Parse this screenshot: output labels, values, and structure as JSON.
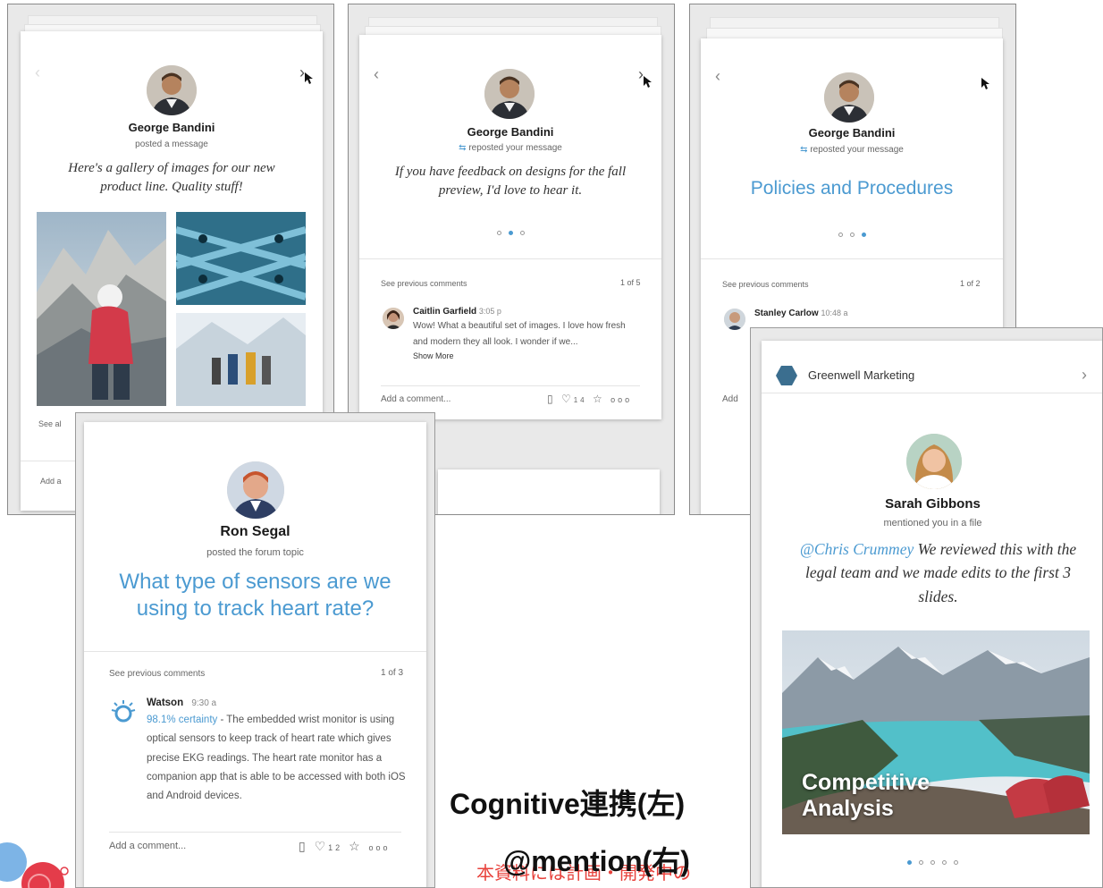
{
  "card1": {
    "name": "George Bandini",
    "action": "posted a message",
    "quote": "Here's a gallery of images for our new product line. Quality stuff!",
    "see_all": "See al",
    "add": "Add a"
  },
  "card2": {
    "name": "George Bandini",
    "action": "reposted your message",
    "quote": "If you have feedback on designs for the fall preview, I'd love to hear it.",
    "see_previous": "See previous comments",
    "count": "1 of 5",
    "comment": {
      "author": "Caitlin Garfield",
      "time": "3:05 p",
      "text": "Wow! What a beautiful set of images. I love how fresh and modern they all look. I wonder if we...",
      "show_more": "Show More"
    },
    "add_comment": "Add a comment...",
    "likes": "14"
  },
  "card3": {
    "name": "George Bandini",
    "action": "reposted your message",
    "title": "Policies and Procedures",
    "see_previous": "See previous comments",
    "count": "1 of 2",
    "comment": {
      "author": "Stanley Carlow",
      "time": "10:48 a"
    },
    "add": "Add"
  },
  "card4": {
    "name": "Ron Segal",
    "action": "posted the forum topic",
    "title": "What type of sensors are we using to track heart rate?",
    "see_previous": "See previous comments",
    "count": "1 of 3",
    "comment": {
      "author": "Watson",
      "time": "9:30 a",
      "certainty": "98.1% certainty",
      "text": " - The embedded wrist monitor is using optical sensors to keep track of heart rate which gives precise EKG readings. The heart rate monitor has a companion app that is able to be accessed with both iOS and Android devices."
    },
    "add_comment": "Add a comment...",
    "likes": "12"
  },
  "card5": {
    "community": "Greenwell Marketing",
    "name": "Sarah Gibbons",
    "action": "mentioned you in a file",
    "mention": "@Chris Crummey",
    "quote": " We reviewed this with the legal team and we made edits to the first 3 slides.",
    "file_title_1": "Competitive",
    "file_title_2": "Analysis"
  },
  "captions": {
    "cognitive": "Cognitive連携(左)",
    "mention": "@mention(右)",
    "disclaimer": "本資料には計画・開発中の"
  },
  "colors": {
    "accent": "#4b9ad1",
    "disclaimer": "#e8413b"
  },
  "icons": [
    "back-chevron-icon",
    "forward-chevron-icon",
    "repost-icon",
    "like-icon",
    "star-icon",
    "more-icon",
    "file-icon",
    "watson-icon",
    "community-hex-icon",
    "cursor-icon"
  ]
}
